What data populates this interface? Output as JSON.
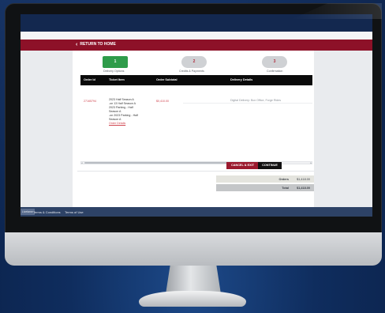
{
  "site": {
    "return_label": "RETURN TO HOME"
  },
  "steps": [
    {
      "number": "1",
      "label": "Delivery Options"
    },
    {
      "number": "2",
      "label": "Credits & Payments"
    },
    {
      "number": "3",
      "label": "Confirmation"
    }
  ],
  "table": {
    "headers": [
      "Order Id",
      "Ticket Item",
      "Order Subtotal",
      "Delivery Details"
    ],
    "row": {
      "order_id": "27165794",
      "items": [
        "2023 Half Season A",
        "-on 13 Half Season A",
        "2023 Parking - Half",
        "Season A",
        "-on 2023 Parking - Half",
        "Season A"
      ],
      "items_link": "Order Details",
      "subtotal": "$0,410.00",
      "delivery": "Digital Delivery: Box Office, Forge Rides"
    }
  },
  "totals": {
    "orders_label": "Orders",
    "orders_value": "$1,418.00",
    "total_label": "Total",
    "total_value": "$1,418.00"
  },
  "buttons": {
    "cancel": "CANCEL & EXIT",
    "continue": "CONTINUE"
  },
  "footer": {
    "tag": "Livefame",
    "terms_conditions": "Terms & Conditions",
    "terms_use": "Terms of Use"
  },
  "colors": {
    "header_navy": "#13284f",
    "brand_red": "#8d1128",
    "step_active": "#2f9c4a",
    "continue_black": "#111111"
  }
}
